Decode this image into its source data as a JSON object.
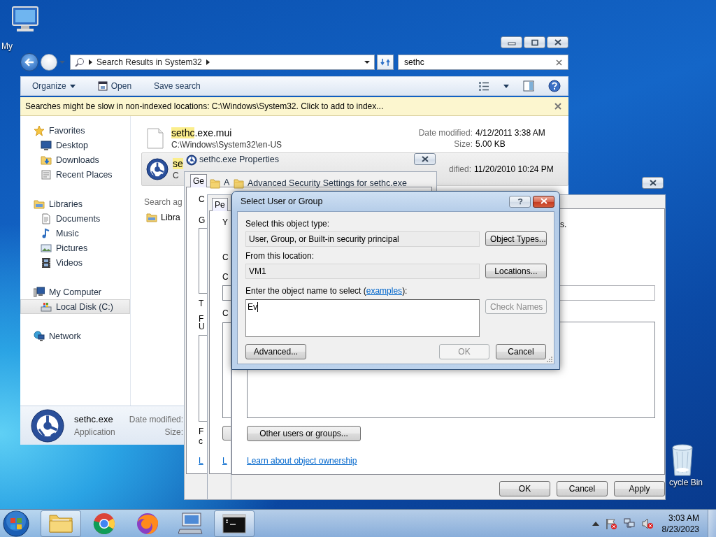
{
  "desktop": {
    "icons": [
      {
        "label": "My"
      },
      {
        "label": "cycle Bin"
      }
    ]
  },
  "explorer": {
    "address": "Search Results in System32",
    "search": {
      "value": "sethc"
    },
    "toolbar": [
      "Organize",
      "Open",
      "Save search"
    ],
    "info_bar": "Searches might be slow in non-indexed locations: C:\\Windows\\System32. Click to add to index...",
    "nav": [
      {
        "label": "Favorites",
        "selected": false,
        "children": [
          {
            "label": "Desktop",
            "selected": false
          },
          {
            "label": "Downloads",
            "selected": false
          },
          {
            "label": "Recent Places",
            "selected": false
          }
        ]
      },
      {
        "label": "Libraries",
        "selected": false,
        "children": [
          {
            "label": "Documents",
            "selected": false
          },
          {
            "label": "Music",
            "selected": false
          },
          {
            "label": "Pictures",
            "selected": false
          },
          {
            "label": "Videos",
            "selected": false
          }
        ]
      },
      {
        "label": "My Computer",
        "selected": false,
        "children": [
          {
            "label": "Local Disk (C:)",
            "selected": true
          }
        ]
      },
      {
        "label": "Network",
        "selected": false
      }
    ],
    "results": [
      {
        "name_match": "sethc",
        "name_rest": ".exe.mui",
        "path": "C:\\Windows\\System32\\en-US",
        "date_label": "Date modified:",
        "date": "4/12/2011 3:38 AM",
        "size_label": "Size:",
        "size": "5.00 KB",
        "selected": false
      },
      {
        "name_match": "se",
        "path": "C",
        "date_label": "dified:",
        "date": "11/20/2010 10:24 PM",
        "selected": true
      }
    ],
    "search_again": "Search ag",
    "library": "Libra",
    "details": {
      "name": "sethc.exe",
      "type": "Application",
      "date_label": "Date modified:",
      "size_label": "Size:"
    }
  },
  "properties": {
    "title": "sethc.exe Properties",
    "tab": "Ge",
    "fragments": [
      {
        "kind": "text",
        "text": "C"
      },
      {
        "kind": "text",
        "text": "G"
      },
      {
        "kind": "text",
        "text": "T"
      },
      {
        "kind": "text",
        "text": "F"
      },
      {
        "kind": "text",
        "text": "U"
      },
      {
        "kind": "text",
        "text": "F"
      },
      {
        "kind": "text",
        "text": "c"
      },
      {
        "kind": "link",
        "text": "L"
      }
    ]
  },
  "advanced_back": {
    "title": "A",
    "tab": "Pe",
    "fragments": [
      {
        "kind": "text",
        "text": "Y"
      },
      {
        "kind": "text",
        "text": "C"
      },
      {
        "kind": "text",
        "text": "C"
      },
      {
        "kind": "text",
        "text": "C"
      },
      {
        "kind": "link",
        "text": "L"
      }
    ]
  },
  "advanced": {
    "title": "Advanced Security Settings for sethc.exe",
    "description_end": "s.",
    "other_button": "Other users or groups...",
    "link": "Learn about object ownership",
    "buttons": [
      "OK",
      "Cancel",
      "Apply"
    ]
  },
  "select_dialog": {
    "title": "Select User or Group",
    "object_type_label": "Select this object type:",
    "object_type": "User, Group, or Built-in security principal",
    "object_types_button": "Object Types...",
    "location_label": "From this location:",
    "location": "VM1",
    "locations_button": "Locations...",
    "name_label_before": "Enter the object name to select (",
    "name_link": "examples",
    "name_label_after": "):",
    "name_value": "Ev",
    "check_names": {
      "label": "Check Names",
      "disabled": true
    },
    "advanced_button": "Advanced...",
    "ok": {
      "label": "OK",
      "disabled": true
    },
    "cancel": "Cancel"
  },
  "taskbar": {
    "apps": [
      {
        "kind": "explorer",
        "running": true
      },
      {
        "kind": "chrome",
        "running": false
      },
      {
        "kind": "firefox",
        "running": false
      },
      {
        "kind": "remote",
        "running": false
      },
      {
        "kind": "cmd",
        "running": true
      }
    ],
    "time": "3:03 AM",
    "date": "8/23/2023"
  }
}
